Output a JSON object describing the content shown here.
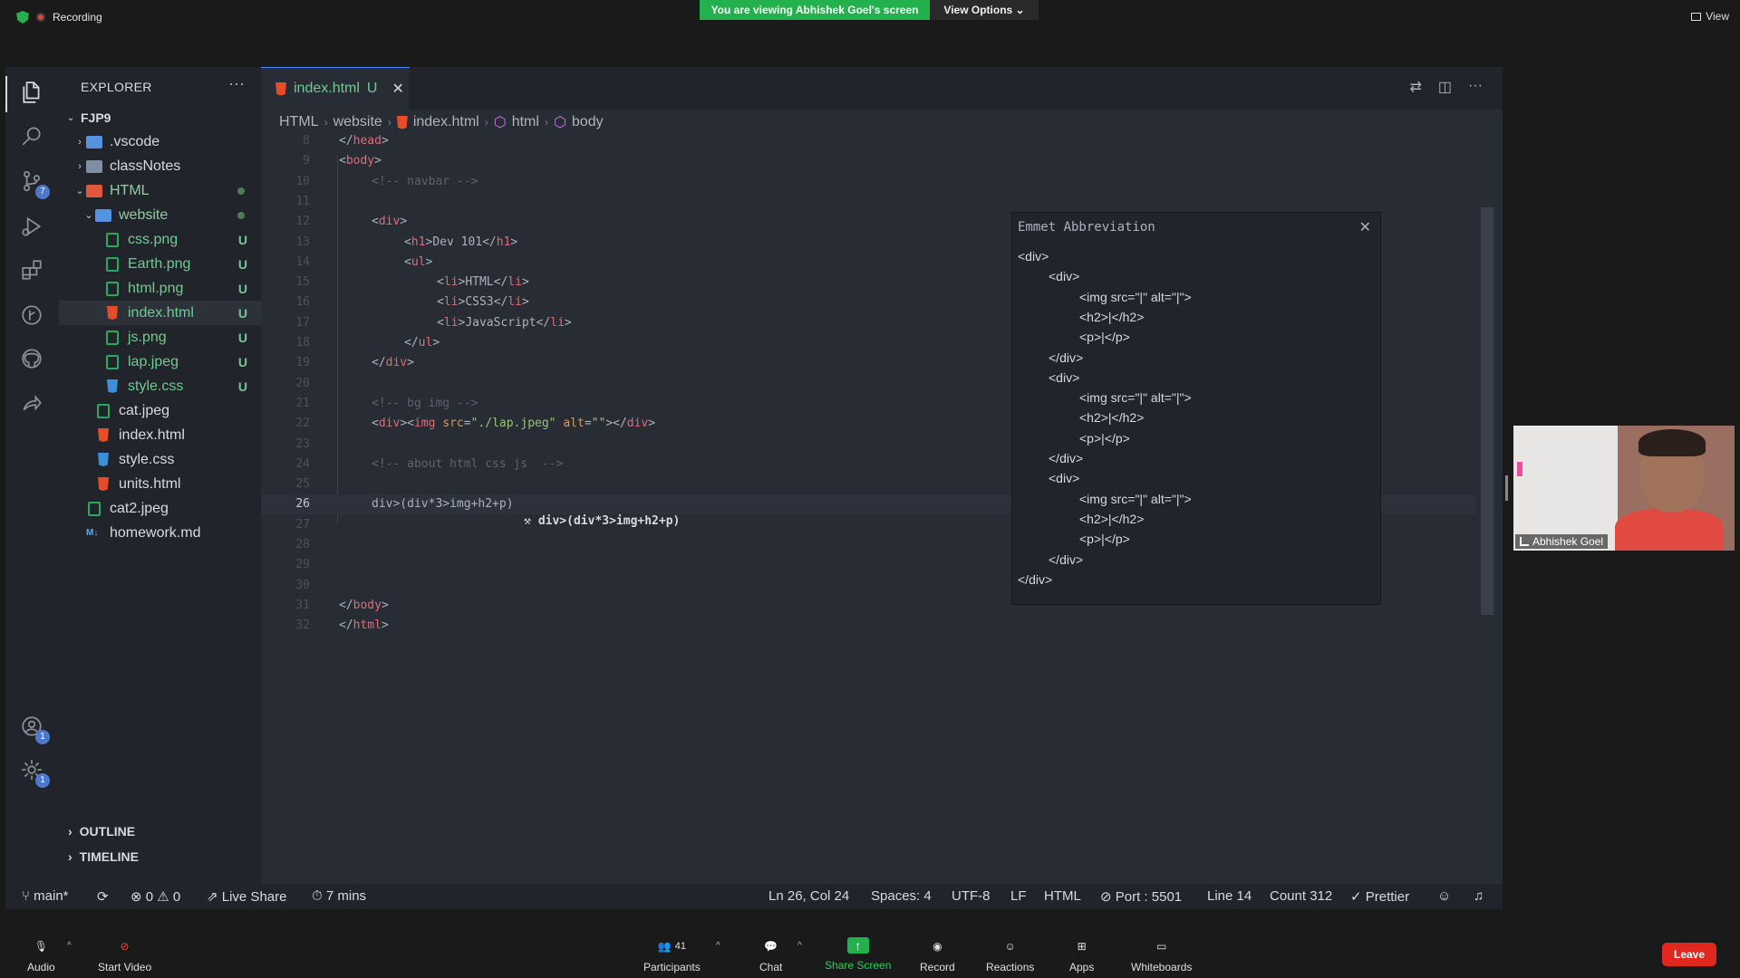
{
  "zoom_top": {
    "recording": "Recording",
    "viewing_banner": "You are viewing Abhishek Goel's screen",
    "view_options": "View Options ⌄",
    "view": "View"
  },
  "explorer": {
    "title": "EXPLORER",
    "more": "···",
    "root": "FJP9",
    "items": [
      {
        "label": ".vscode",
        "icon": "folder-vscode-icon",
        "depth": 1,
        "chevron": "›",
        "status": ""
      },
      {
        "label": "classNotes",
        "icon": "folder-icon",
        "depth": 1,
        "chevron": "›",
        "status": ""
      },
      {
        "label": "HTML",
        "icon": "folder-html-icon",
        "depth": 1,
        "chevron": "⌄",
        "status": "dot"
      },
      {
        "label": "website",
        "icon": "folder-website-icon",
        "depth": 2,
        "chevron": "⌄",
        "status": "dot"
      },
      {
        "label": "css.png",
        "icon": "image-file-icon",
        "depth": 3,
        "chevron": "",
        "status": "U"
      },
      {
        "label": "Earth.png",
        "icon": "image-file-icon",
        "depth": 3,
        "chevron": "",
        "status": "U"
      },
      {
        "label": "html.png",
        "icon": "image-file-icon",
        "depth": 3,
        "chevron": "",
        "status": "U"
      },
      {
        "label": "index.html",
        "icon": "html-file-icon",
        "depth": 3,
        "chevron": "",
        "status": "U"
      },
      {
        "label": "js.png",
        "icon": "image-file-icon",
        "depth": 3,
        "chevron": "",
        "status": "U"
      },
      {
        "label": "lap.jpeg",
        "icon": "image-file-icon",
        "depth": 3,
        "chevron": "",
        "status": "U"
      },
      {
        "label": "style.css",
        "icon": "css-file-icon",
        "depth": 3,
        "chevron": "",
        "status": "U"
      },
      {
        "label": "cat.jpeg",
        "icon": "image-file-icon",
        "depth": 2,
        "chevron": "",
        "status": ""
      },
      {
        "label": "index.html",
        "icon": "html-file-icon",
        "depth": 2,
        "chevron": "",
        "status": ""
      },
      {
        "label": "style.css",
        "icon": "css-file-icon",
        "depth": 2,
        "chevron": "",
        "status": ""
      },
      {
        "label": "units.html",
        "icon": "html-file-icon",
        "depth": 2,
        "chevron": "",
        "status": ""
      },
      {
        "label": "cat2.jpeg",
        "icon": "image-file-icon",
        "depth": 1,
        "chevron": "",
        "status": ""
      },
      {
        "label": "homework.md",
        "icon": "markdown-file-icon",
        "depth": 1,
        "chevron": "",
        "status": ""
      }
    ],
    "outline": "OUTLINE",
    "timeline": "TIMELINE"
  },
  "activity_badges": {
    "source_control": "7",
    "accounts": "1",
    "settings": "1"
  },
  "tab": {
    "name": "index.html",
    "status": "U",
    "close": "✕"
  },
  "breadcrumbs": [
    "HTML",
    "website",
    "index.html",
    "html",
    "body"
  ],
  "code_lines": [
    {
      "n": "8",
      "parts": [
        [
          "br",
          "</"
        ],
        [
          "tag",
          "head"
        ],
        [
          "br",
          ">"
        ]
      ],
      "indent": 0
    },
    {
      "n": "9",
      "parts": [
        [
          "br",
          "<"
        ],
        [
          "tag",
          "body"
        ],
        [
          "br",
          ">"
        ]
      ],
      "indent": 0
    },
    {
      "n": "10",
      "parts": [
        [
          "cmt",
          "<!-- navbar -->"
        ]
      ],
      "indent": 1
    },
    {
      "n": "11",
      "parts": [],
      "indent": 0
    },
    {
      "n": "12",
      "parts": [
        [
          "br",
          "<"
        ],
        [
          "tag",
          "div"
        ],
        [
          "br",
          ">"
        ]
      ],
      "indent": 1
    },
    {
      "n": "13",
      "parts": [
        [
          "br",
          "<"
        ],
        [
          "tag",
          "h1"
        ],
        [
          "br",
          ">"
        ],
        [
          "txt",
          "Dev 101"
        ],
        [
          "br",
          "</"
        ],
        [
          "tag",
          "h1"
        ],
        [
          "br",
          ">"
        ]
      ],
      "indent": 2
    },
    {
      "n": "14",
      "parts": [
        [
          "br",
          "<"
        ],
        [
          "tag",
          "ul"
        ],
        [
          "br",
          ">"
        ]
      ],
      "indent": 2
    },
    {
      "n": "15",
      "parts": [
        [
          "br",
          "<"
        ],
        [
          "tag",
          "li"
        ],
        [
          "br",
          ">"
        ],
        [
          "txt",
          "HTML"
        ],
        [
          "br",
          "</"
        ],
        [
          "tag",
          "li"
        ],
        [
          "br",
          ">"
        ]
      ],
      "indent": 3
    },
    {
      "n": "16",
      "parts": [
        [
          "br",
          "<"
        ],
        [
          "tag",
          "li"
        ],
        [
          "br",
          ">"
        ],
        [
          "txt",
          "CSS3"
        ],
        [
          "br",
          "</"
        ],
        [
          "tag",
          "li"
        ],
        [
          "br",
          ">"
        ]
      ],
      "indent": 3
    },
    {
      "n": "17",
      "parts": [
        [
          "br",
          "<"
        ],
        [
          "tag",
          "li"
        ],
        [
          "br",
          ">"
        ],
        [
          "txt",
          "JavaScript"
        ],
        [
          "br",
          "</"
        ],
        [
          "tag",
          "li"
        ],
        [
          "br",
          ">"
        ]
      ],
      "indent": 3
    },
    {
      "n": "18",
      "parts": [
        [
          "br",
          "</"
        ],
        [
          "tag",
          "ul"
        ],
        [
          "br",
          ">"
        ]
      ],
      "indent": 2
    },
    {
      "n": "19",
      "parts": [
        [
          "br",
          "</"
        ],
        [
          "tag",
          "div"
        ],
        [
          "br",
          ">"
        ]
      ],
      "indent": 1
    },
    {
      "n": "20",
      "parts": [],
      "indent": 0
    },
    {
      "n": "21",
      "parts": [
        [
          "cmt",
          "<!-- bg img -->"
        ]
      ],
      "indent": 1
    },
    {
      "n": "22",
      "parts": [
        [
          "br",
          "<"
        ],
        [
          "tag",
          "div"
        ],
        [
          "br",
          "><"
        ],
        [
          "tag",
          "img"
        ],
        [
          "txt",
          " "
        ],
        [
          "attr",
          "src"
        ],
        [
          "br",
          "="
        ],
        [
          "str",
          "\"./lap.jpeg\""
        ],
        [
          "txt",
          " "
        ],
        [
          "attr",
          "alt"
        ],
        [
          "br",
          "="
        ],
        [
          "str",
          "\"\""
        ],
        [
          "br",
          "></"
        ],
        [
          "tag",
          "div"
        ],
        [
          "br",
          ">"
        ]
      ],
      "indent": 1
    },
    {
      "n": "23",
      "parts": [],
      "indent": 0
    },
    {
      "n": "24",
      "parts": [
        [
          "cmt",
          "<!-- about html css js  -->"
        ]
      ],
      "indent": 1
    },
    {
      "n": "25",
      "parts": [],
      "indent": 0
    },
    {
      "n": "26",
      "parts": [
        [
          "txt",
          "div>(div*3>img+h2+p)"
        ]
      ],
      "indent": 1
    },
    {
      "n": "27",
      "parts": [],
      "indent": 0
    },
    {
      "n": "28",
      "parts": [],
      "indent": 0
    },
    {
      "n": "29",
      "parts": [],
      "indent": 0
    },
    {
      "n": "30",
      "parts": [],
      "indent": 0
    },
    {
      "n": "31",
      "parts": [
        [
          "br",
          "</"
        ],
        [
          "tag",
          "body"
        ],
        [
          "br",
          ">"
        ]
      ],
      "indent": 0
    },
    {
      "n": "32",
      "parts": [
        [
          "br",
          "</"
        ],
        [
          "tag",
          "html"
        ],
        [
          "br",
          ">"
        ]
      ],
      "indent": 0
    }
  ],
  "current_line": "26",
  "suggestion": "div>(div*3>img+h2+p)",
  "emmet": {
    "title": "Emmet Abbreviation",
    "close": "✕",
    "lines": [
      {
        "indent": 0,
        "text": "<div>"
      },
      {
        "indent": 1,
        "text": "<div>"
      },
      {
        "indent": 2,
        "text": "<img src=\"|\" alt=\"|\">"
      },
      {
        "indent": 2,
        "text": "<h2>|</h2>"
      },
      {
        "indent": 2,
        "text": "<p>|</p>"
      },
      {
        "indent": 1,
        "text": "</div>"
      },
      {
        "indent": 1,
        "text": "<div>"
      },
      {
        "indent": 2,
        "text": "<img src=\"|\" alt=\"|\">"
      },
      {
        "indent": 2,
        "text": "<h2>|</h2>"
      },
      {
        "indent": 2,
        "text": "<p>|</p>"
      },
      {
        "indent": 1,
        "text": "</div>"
      },
      {
        "indent": 1,
        "text": "<div>"
      },
      {
        "indent": 2,
        "text": "<img src=\"|\" alt=\"|\">"
      },
      {
        "indent": 2,
        "text": "<h2>|</h2>"
      },
      {
        "indent": 2,
        "text": "<p>|</p>"
      },
      {
        "indent": 1,
        "text": "</div>"
      },
      {
        "indent": 0,
        "text": "</div>"
      }
    ]
  },
  "statusbar": {
    "branch": "main*",
    "errors": "0",
    "warnings": "0",
    "live_share": "Live Share",
    "time": "7 mins",
    "position": "Ln 26, Col 24",
    "spaces": "Spaces: 4",
    "encoding": "UTF-8",
    "eol": "LF",
    "language": "HTML",
    "port": "Port : 5501",
    "line": "Line 14",
    "count": "Count 312",
    "prettier": "Prettier"
  },
  "video": {
    "name": "Abhishek Goel"
  },
  "zoom_bottom": {
    "audio": "Audio",
    "start_video": "Start Video",
    "participants": "Participants",
    "participants_count": "41",
    "chat": "Chat",
    "share_screen": "Share Screen",
    "record": "Record",
    "reactions": "Reactions",
    "apps": "Apps",
    "whiteboards": "Whiteboards",
    "leave": "Leave"
  },
  "colors": {
    "accent_green": "#23b14d",
    "leave_red": "#e0281e",
    "untracked": "#73c991"
  }
}
